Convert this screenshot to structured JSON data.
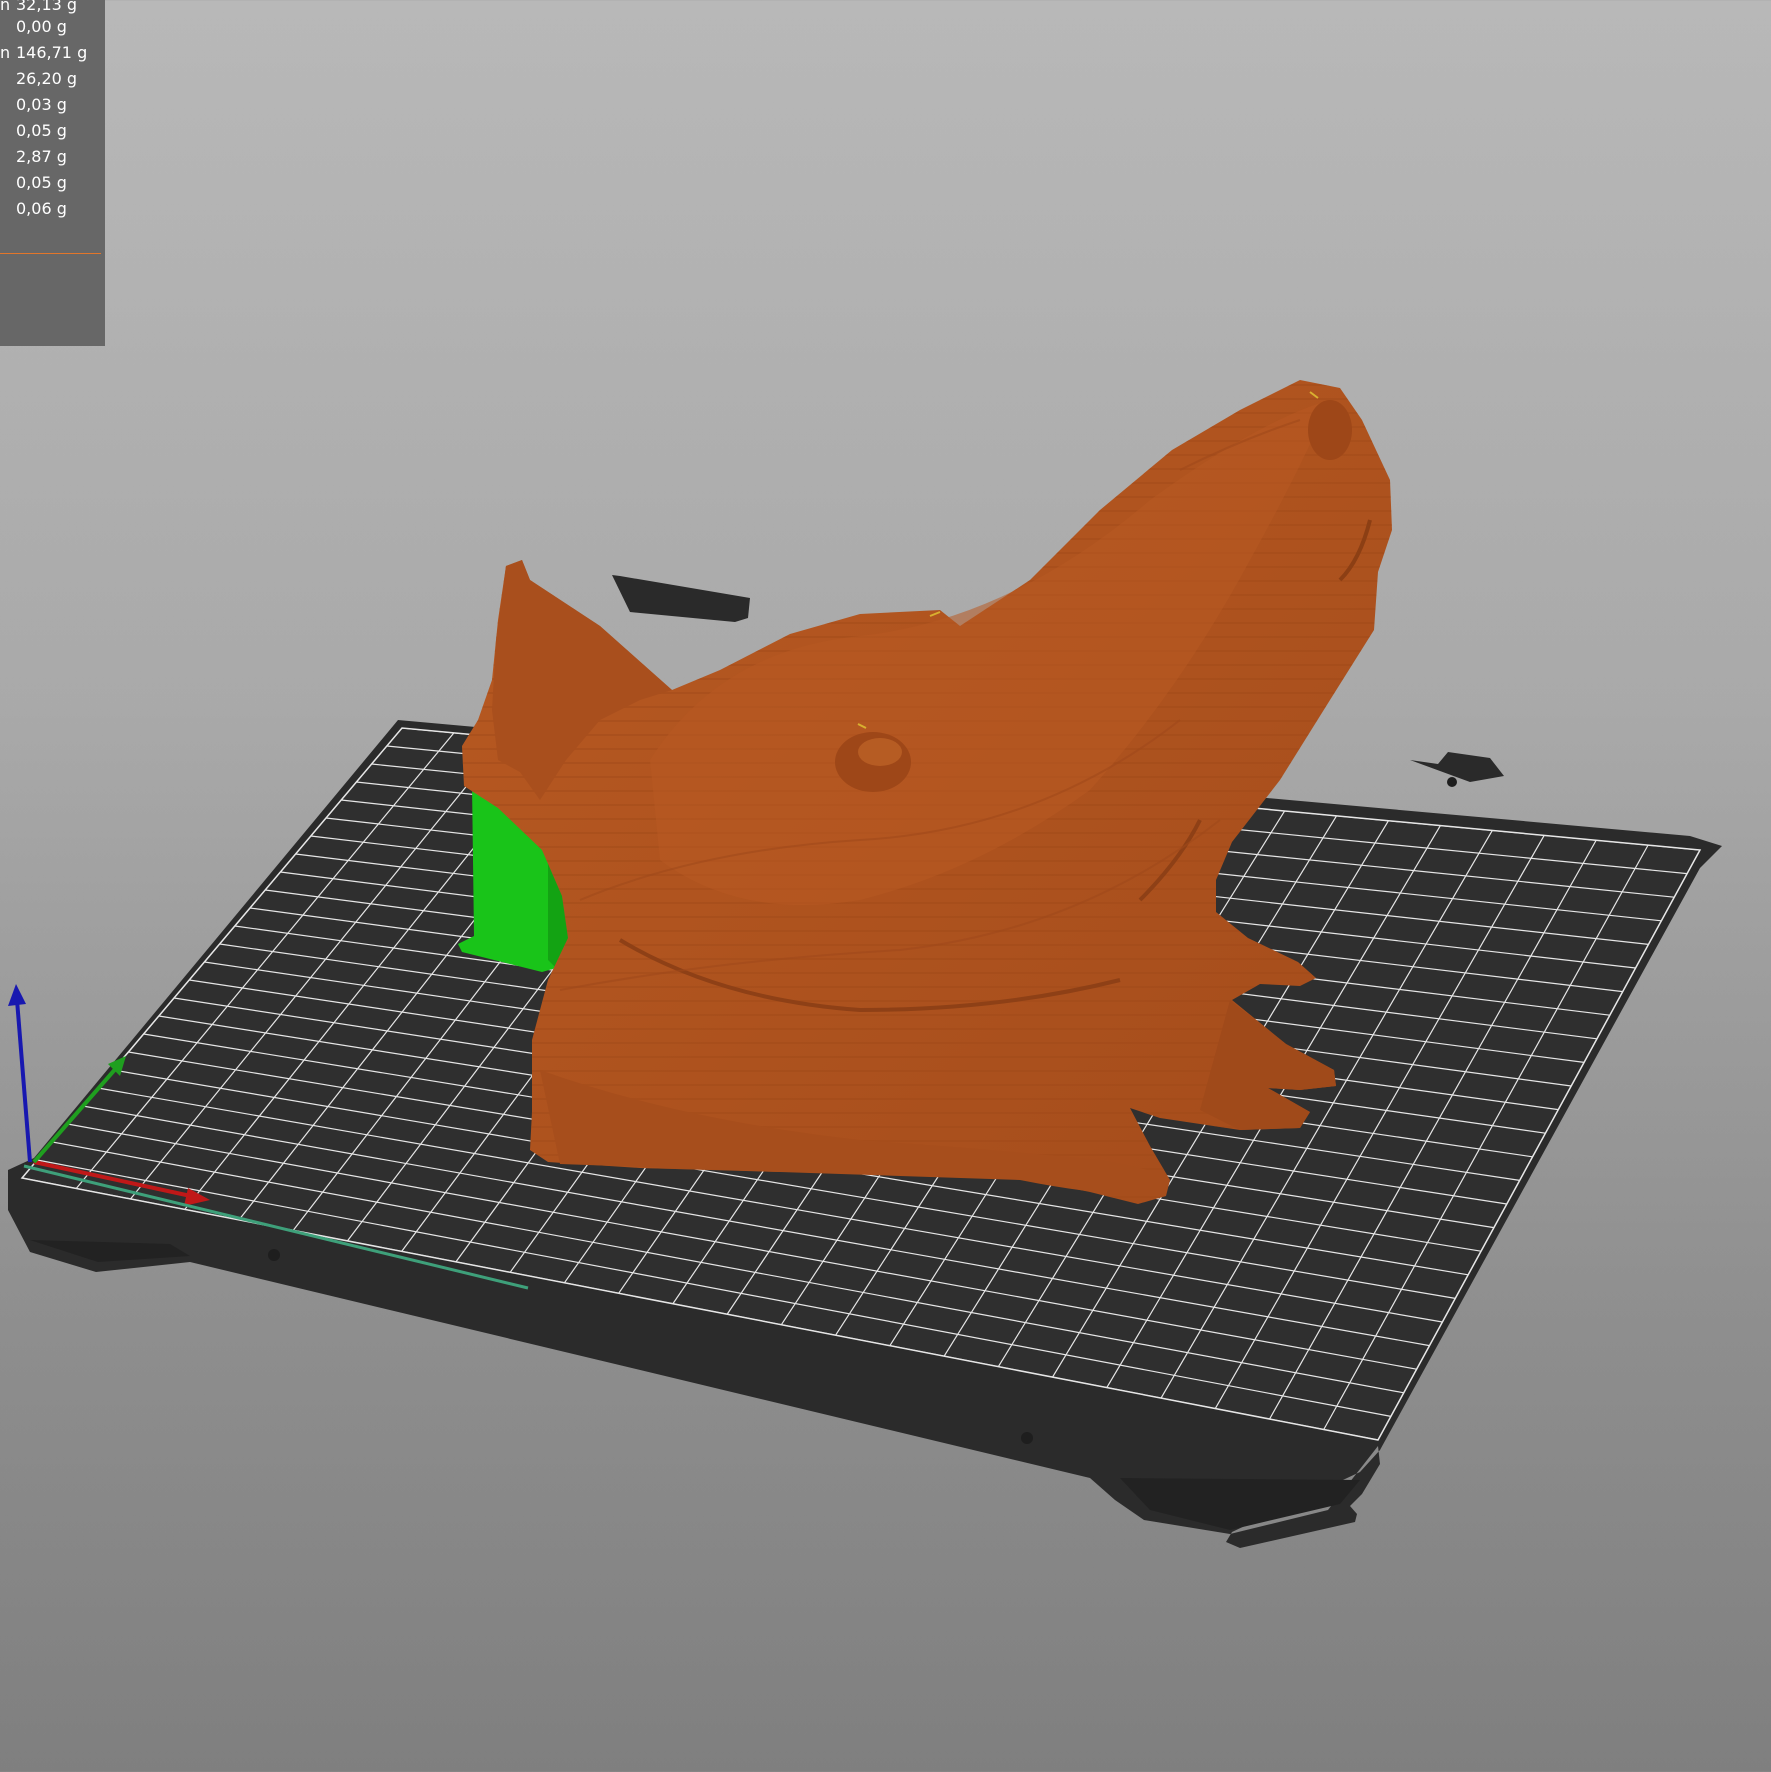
{
  "colors": {
    "background_top": "#b8b8b8",
    "background_bottom": "#7f7f7f",
    "bed": "#2b2b2b",
    "bed_grid": "#e6e6e6",
    "model": "#b0531f",
    "support_tower": "#19c419",
    "axis_x": "#c01818",
    "axis_y": "#1f9f1f",
    "axis_z": "#1818b0",
    "panel": "#676767",
    "panel_separator": "#e2762a"
  },
  "legend": {
    "rows": [
      {
        "prefix": "n",
        "value": "32,13 g"
      },
      {
        "prefix": "",
        "value": "0,00 g"
      },
      {
        "prefix": "n",
        "value": "146,71 g"
      },
      {
        "prefix": "",
        "value": "26,20 g"
      },
      {
        "prefix": "",
        "value": "0,03 g"
      },
      {
        "prefix": "",
        "value": "0,05 g"
      },
      {
        "prefix": "",
        "value": "2,87 g"
      },
      {
        "prefix": "",
        "value": "0,05 g"
      },
      {
        "prefix": "",
        "value": "0,06 g"
      }
    ]
  }
}
